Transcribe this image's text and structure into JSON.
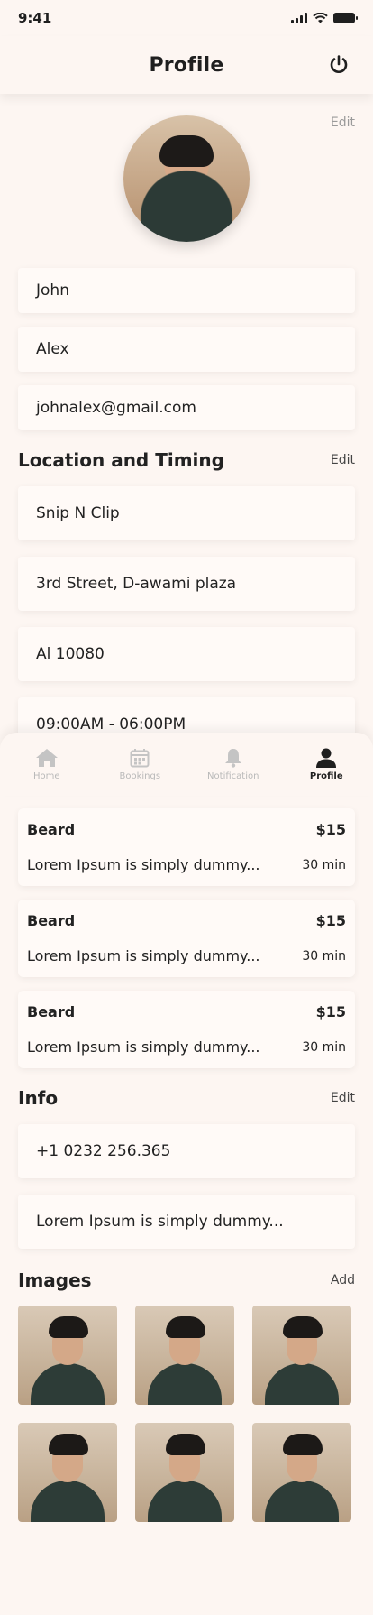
{
  "status": {
    "time": "9:41"
  },
  "header": {
    "title": "Profile",
    "power_icon": "power-icon"
  },
  "profile": {
    "edit_label": "Edit",
    "first_name": "John",
    "last_name": "Alex",
    "email": "johnalex@gmail.com"
  },
  "location": {
    "title": "Location and Timing",
    "edit_label": "Edit",
    "shop_name": "Snip N Clip",
    "address": "3rd Street, D-awami plaza",
    "postal": "Al 10080",
    "timing": "09:00AM - 06:00PM"
  },
  "tabs": [
    {
      "label": "Home",
      "icon": "home-icon",
      "active": false
    },
    {
      "label": "Bookings",
      "icon": "calendar-icon",
      "active": false
    },
    {
      "label": "Notification",
      "icon": "bell-icon",
      "active": false
    },
    {
      "label": "Profile",
      "icon": "person-icon",
      "active": true
    }
  ],
  "services": [
    {
      "name": "Beard",
      "price": "$15",
      "description": "Lorem Ipsum is simply dummy...",
      "duration": "30 min"
    },
    {
      "name": "Beard",
      "price": "$15",
      "description": "Lorem Ipsum is simply dummy...",
      "duration": "30 min"
    },
    {
      "name": "Beard",
      "price": "$15",
      "description": "Lorem Ipsum is simply dummy...",
      "duration": "30 min"
    }
  ],
  "info": {
    "title": "Info",
    "edit_label": "Edit",
    "phone": "+1 0232 256.365",
    "description": "Lorem Ipsum is simply dummy..."
  },
  "images": {
    "title": "Images",
    "add_label": "Add"
  },
  "colors": {
    "background": "#fdf6f2",
    "card": "#fffaf7",
    "text": "#1f1f1f",
    "muted": "#b9b9b9"
  }
}
